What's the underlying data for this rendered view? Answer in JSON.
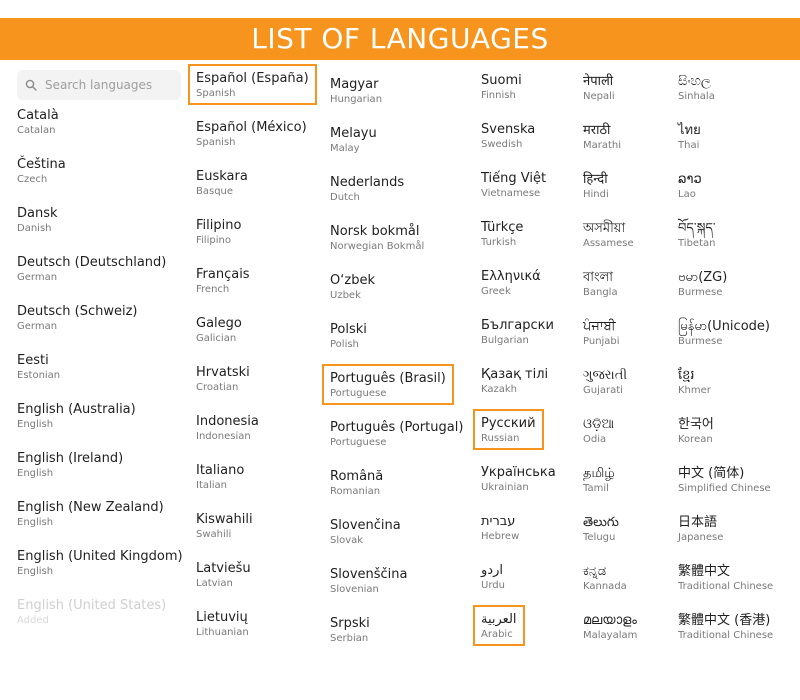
{
  "header": {
    "title": "LIST OF LANGUAGES"
  },
  "search": {
    "placeholder": "Search languages"
  },
  "columns": [
    {
      "items": [
        {
          "name": "Català",
          "sub": "Catalan"
        },
        {
          "name": "Čeština",
          "sub": "Czech"
        },
        {
          "name": "Dansk",
          "sub": "Danish"
        },
        {
          "name": "Deutsch (Deutschland)",
          "sub": "German"
        },
        {
          "name": "Deutsch (Schweiz)",
          "sub": "German"
        },
        {
          "name": "Eesti",
          "sub": "Estonian"
        },
        {
          "name": "English (Australia)",
          "sub": "English"
        },
        {
          "name": "English (Ireland)",
          "sub": "English"
        },
        {
          "name": "English (New Zealand)",
          "sub": "English"
        },
        {
          "name": "English (United Kingdom)",
          "sub": "English"
        },
        {
          "name": "English (United States)",
          "sub": "Added",
          "disabled": true
        }
      ]
    },
    {
      "items": [
        {
          "name": "Español (España)",
          "sub": "Spanish",
          "highlighted": true
        },
        {
          "name": "Español (México)",
          "sub": "Spanish"
        },
        {
          "name": "Euskara",
          "sub": "Basque"
        },
        {
          "name": "Filipino",
          "sub": "Filipino"
        },
        {
          "name": "Français",
          "sub": "French"
        },
        {
          "name": "Galego",
          "sub": "Galician"
        },
        {
          "name": "Hrvatski",
          "sub": "Croatian"
        },
        {
          "name": "Indonesia",
          "sub": "Indonesian"
        },
        {
          "name": "Italiano",
          "sub": "Italian"
        },
        {
          "name": "Kiswahili",
          "sub": "Swahili"
        },
        {
          "name": "Latviešu",
          "sub": "Latvian"
        },
        {
          "name": "Lietuvių",
          "sub": "Lithuanian"
        }
      ]
    },
    {
      "items": [
        {
          "name": "Magyar",
          "sub": "Hungarian"
        },
        {
          "name": "Melayu",
          "sub": "Malay"
        },
        {
          "name": "Nederlands",
          "sub": "Dutch"
        },
        {
          "name": "Norsk bokmål",
          "sub": "Norwegian Bokmål"
        },
        {
          "name": "O‘zbek",
          "sub": "Uzbek"
        },
        {
          "name": "Polski",
          "sub": "Polish"
        },
        {
          "name": "Português (Brasil)",
          "sub": "Portuguese",
          "highlighted": true
        },
        {
          "name": "Português (Portugal)",
          "sub": "Portuguese"
        },
        {
          "name": "Română",
          "sub": "Romanian"
        },
        {
          "name": "Slovenčina",
          "sub": "Slovak"
        },
        {
          "name": "Slovenščina",
          "sub": "Slovenian"
        },
        {
          "name": "Srpski",
          "sub": "Serbian"
        }
      ]
    },
    {
      "items": [
        {
          "name": "Suomi",
          "sub": "Finnish"
        },
        {
          "name": "Svenska",
          "sub": "Swedish"
        },
        {
          "name": "Tiếng Việt",
          "sub": "Vietnamese"
        },
        {
          "name": "Türkçe",
          "sub": "Turkish"
        },
        {
          "name": "Ελληνικά",
          "sub": "Greek"
        },
        {
          "name": "Български",
          "sub": "Bulgarian"
        },
        {
          "name": "Қазақ тілі",
          "sub": "Kazakh"
        },
        {
          "name": "Русский",
          "sub": "Russian",
          "highlighted": true
        },
        {
          "name": "Українська",
          "sub": "Ukrainian"
        },
        {
          "name": "עברית",
          "sub": "Hebrew"
        },
        {
          "name": "اردو",
          "sub": "Urdu"
        },
        {
          "name": "العربية",
          "sub": "Arabic",
          "highlighted": true
        }
      ]
    },
    {
      "items": [
        {
          "name": "नेपाली",
          "sub": "Nepali"
        },
        {
          "name": "मराठी",
          "sub": "Marathi"
        },
        {
          "name": "हिन्दी",
          "sub": "Hindi"
        },
        {
          "name": "অসমীয়া",
          "sub": "Assamese"
        },
        {
          "name": "বাংলা",
          "sub": "Bangla"
        },
        {
          "name": "ਪੰਜਾਬੀ",
          "sub": "Punjabi"
        },
        {
          "name": "ગુજરાતી",
          "sub": "Gujarati"
        },
        {
          "name": "ଓଡ଼ିଆ",
          "sub": "Odia"
        },
        {
          "name": "தமிழ்",
          "sub": "Tamil"
        },
        {
          "name": "తెలుగు",
          "sub": "Telugu"
        },
        {
          "name": "ಕನ್ನಡ",
          "sub": "Kannada"
        },
        {
          "name": "മലയാളം",
          "sub": "Malayalam"
        }
      ]
    },
    {
      "items": [
        {
          "name": "සිංහල",
          "sub": "Sinhala"
        },
        {
          "name": "ไทย",
          "sub": "Thai"
        },
        {
          "name": "ລາວ",
          "sub": "Lao"
        },
        {
          "name": "བོད་སྐད་",
          "sub": "Tibetan"
        },
        {
          "name": "ဗမာ(ZG)",
          "sub": "Burmese"
        },
        {
          "name": "မြန်မာ(Unicode)",
          "sub": "Burmese"
        },
        {
          "name": "ខ្មែរ",
          "sub": "Khmer"
        },
        {
          "name": "한국어",
          "sub": "Korean"
        },
        {
          "name": "中文 (简体)",
          "sub": "Simplified Chinese"
        },
        {
          "name": "日本語",
          "sub": "Japanese"
        },
        {
          "name": "繁體中文",
          "sub": "Traditional Chinese"
        },
        {
          "name": "繁體中文 (香港)",
          "sub": "Traditional Chinese"
        }
      ]
    }
  ],
  "colors": {
    "accent": "#f7941d",
    "text": "#1f1f1f",
    "subtext": "#7a7a7a",
    "disabled": "#cfcfcf",
    "search_bg": "#f3f3f3"
  },
  "icons": {
    "search": "search-icon"
  }
}
